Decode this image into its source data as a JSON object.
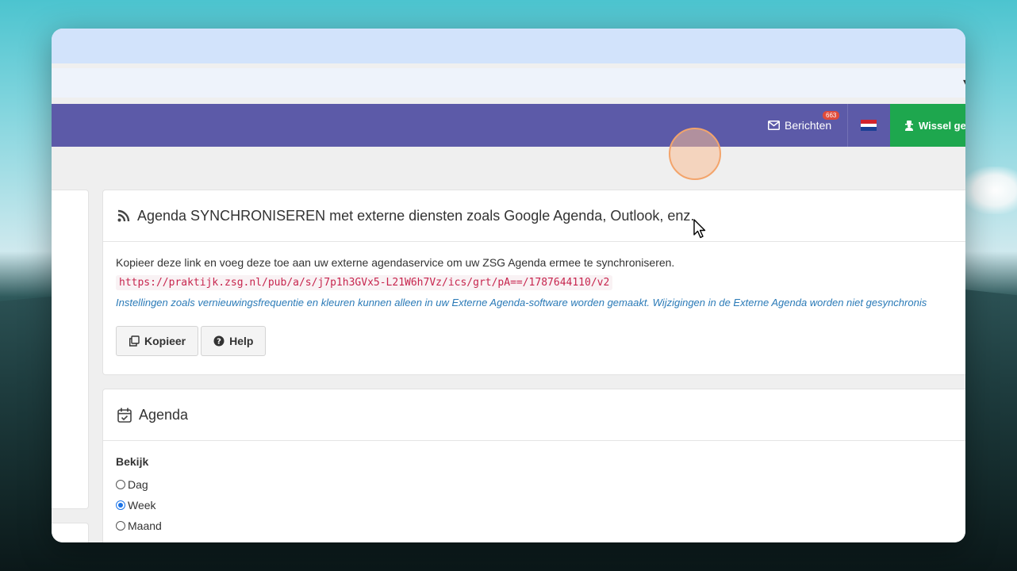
{
  "navbar": {
    "messages_label": "Berichten",
    "messages_count": "663",
    "switch_label": "Wissel ge"
  },
  "sync_card": {
    "title": "Agenda SYNCHRONISEREN met externe diensten zoals Google Agenda, Outlook, enz.",
    "description": "Kopieer deze link en voeg deze toe aan uw externe agendaservice om uw ZSG Agenda ermee te synchroniseren.",
    "link": "https://praktijk.zsg.nl/pub/a/s/j7p1h3GVx5-L21W6h7Vz/ics/grt/pA==/1787644110/v2",
    "note": "Instellingen zoals vernieuwingsfrequentie en kleuren kunnen alleen in uw Externe Agenda-software worden gemaakt. Wijzigingen in de Externe Agenda worden niet gesynchronis",
    "copy_label": "Kopieer",
    "help_label": "Help"
  },
  "agenda_card": {
    "title": "Agenda",
    "view_label": "Bekijk",
    "view_options": [
      "Dag",
      "Week",
      "Maand"
    ],
    "selected_view": "Week"
  },
  "colors": {
    "navbar": "#5c5aa8",
    "switch_button": "#1ea74e",
    "badge": "#e04b3a",
    "link_text": "#c7254e",
    "note_text": "#2a7ab7"
  }
}
